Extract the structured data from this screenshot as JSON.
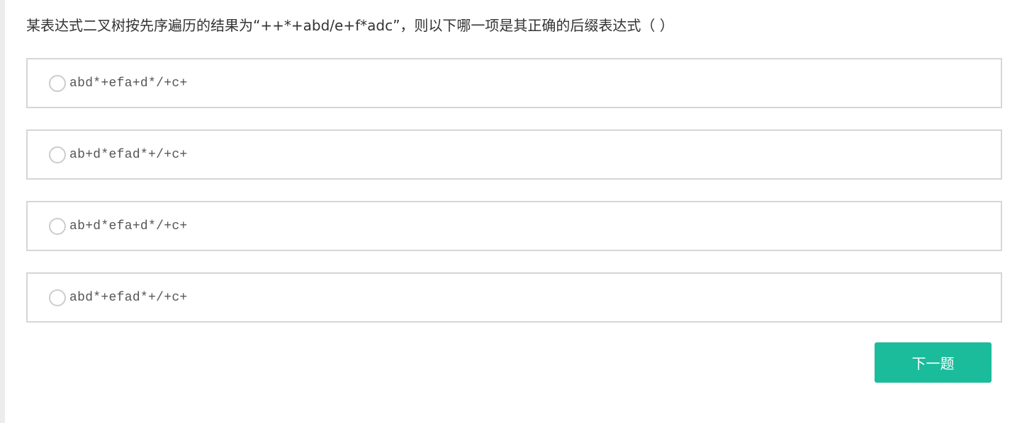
{
  "question": {
    "text": "某表达式二叉树按先序遍历的结果为“++*+abd/e+f*adc”，则以下哪一项是其正确的后缀表达式（ ）"
  },
  "options": [
    {
      "label": "abd*+efa+d*/+c+"
    },
    {
      "label": "ab+d*efad*+/+c+"
    },
    {
      "label": "ab+d*efa+d*/+c+"
    },
    {
      "label": "abd*+efad*+/+c+"
    }
  ],
  "actions": {
    "next_label": "下一题"
  },
  "colors": {
    "accent": "#1abc9c",
    "border": "#d6d6d6",
    "text": "#333333"
  }
}
